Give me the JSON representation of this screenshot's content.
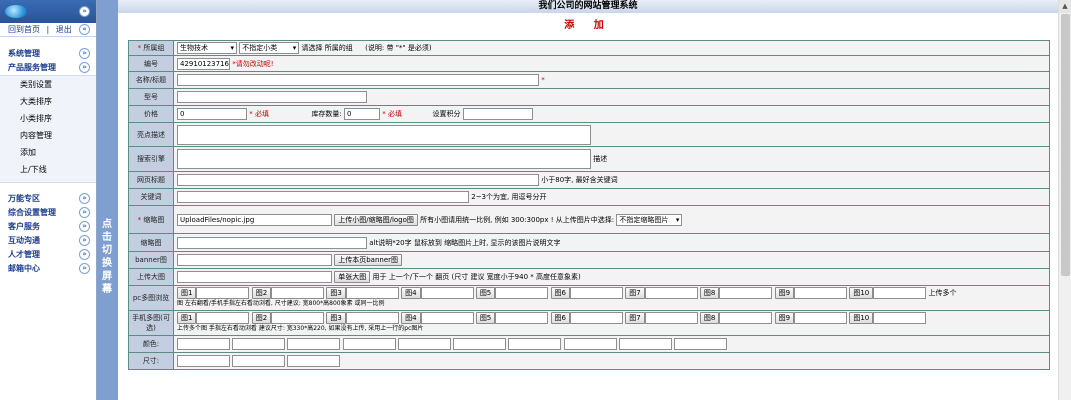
{
  "app": {
    "title": "我们公司的网站管理系统",
    "form_title": "添 加",
    "toggle_label": "点击切换屏幕"
  },
  "sidebar": {
    "top_links": [
      "回到首页",
      "退出"
    ],
    "menus": [
      {
        "label": "系统管理"
      },
      {
        "label": "产品服务管理",
        "items": [
          "类别设置",
          "大类排序",
          "小类排序",
          "内容管理",
          "添加",
          "上/下线"
        ]
      },
      {
        "label": "万能专区"
      },
      {
        "label": "综合设置管理"
      },
      {
        "label": "客户服务"
      },
      {
        "label": "互动沟通"
      },
      {
        "label": "人才管理"
      },
      {
        "label": "邮箱中心"
      }
    ]
  },
  "form": {
    "category": {
      "label": "所属组",
      "sel1": "生物技术",
      "sel2": "不指定小类",
      "hint": "请选择 所属的组",
      "note": "(说明: 带 \"*\" 是必须)"
    },
    "code": {
      "label": "编号",
      "value": "42910123716",
      "hint": "*请勿改动呢!"
    },
    "name": {
      "label": "名称/标题"
    },
    "model": {
      "label": "型号"
    },
    "price": {
      "label": "价格",
      "value": "0",
      "req": "* 必填",
      "stock_label": "库存数量:",
      "stock_value": "0",
      "stock_req": "* 必填",
      "points_label": "设置积分"
    },
    "highlight": {
      "label": "亮点描述"
    },
    "seo": {
      "label": "搜索引擎",
      "suffix": "描述"
    },
    "page_title": {
      "label": "网页标题",
      "hint": "小于80字, 最好含关键词"
    },
    "keywords": {
      "label": "关键词",
      "hint": "2~3个为宜, 用逗号分开"
    },
    "thumb": {
      "label": "缩略图",
      "value": "UploadFiles/nopic.jpg",
      "button": "上传小图/缩略图/logo图",
      "hint": "所有小图请用统一比例, 例如 300:300px ! 从上传图片中选择:",
      "select": "不指定缩略图片"
    },
    "thumb_desc": {
      "label": "缩略图",
      "hint": "alt说明*20字 鼠标放到 缩略图片上时, 显示的该图片说明文字"
    },
    "banner": {
      "label": "banner图",
      "button": "上传本页banner图"
    },
    "big": {
      "label": "上传大图",
      "button": "单张大图",
      "hint": "用于 上一个/下一个 翻页 (尺寸 建议 宽度小于940 * 高度任意象素)"
    },
    "pc_gallery": {
      "label": "pc多图浏览",
      "buttons": [
        "图1",
        "图2",
        "图3",
        "图4",
        "图5",
        "图6",
        "图7",
        "图8",
        "图9",
        "图10"
      ],
      "suffix": "上传多个",
      "note": "图 左右翻看/手机手指左右看动浏看, 尺寸建议: 宽800*高800象素 或同一比例"
    },
    "mobile_gallery": {
      "label": "手机多图(可选)",
      "buttons": [
        "图1",
        "图2",
        "图3",
        "图4",
        "图5",
        "图6",
        "图7",
        "图8",
        "图9",
        "图10"
      ],
      "note": "上传多个图 手指左右看动浏看 建议尺寸: 宽330*高220, 如果没有上传, 采用上一行的pc图片"
    },
    "color": {
      "label": "颜色:"
    },
    "size": {
      "label": "尺寸:"
    }
  }
}
